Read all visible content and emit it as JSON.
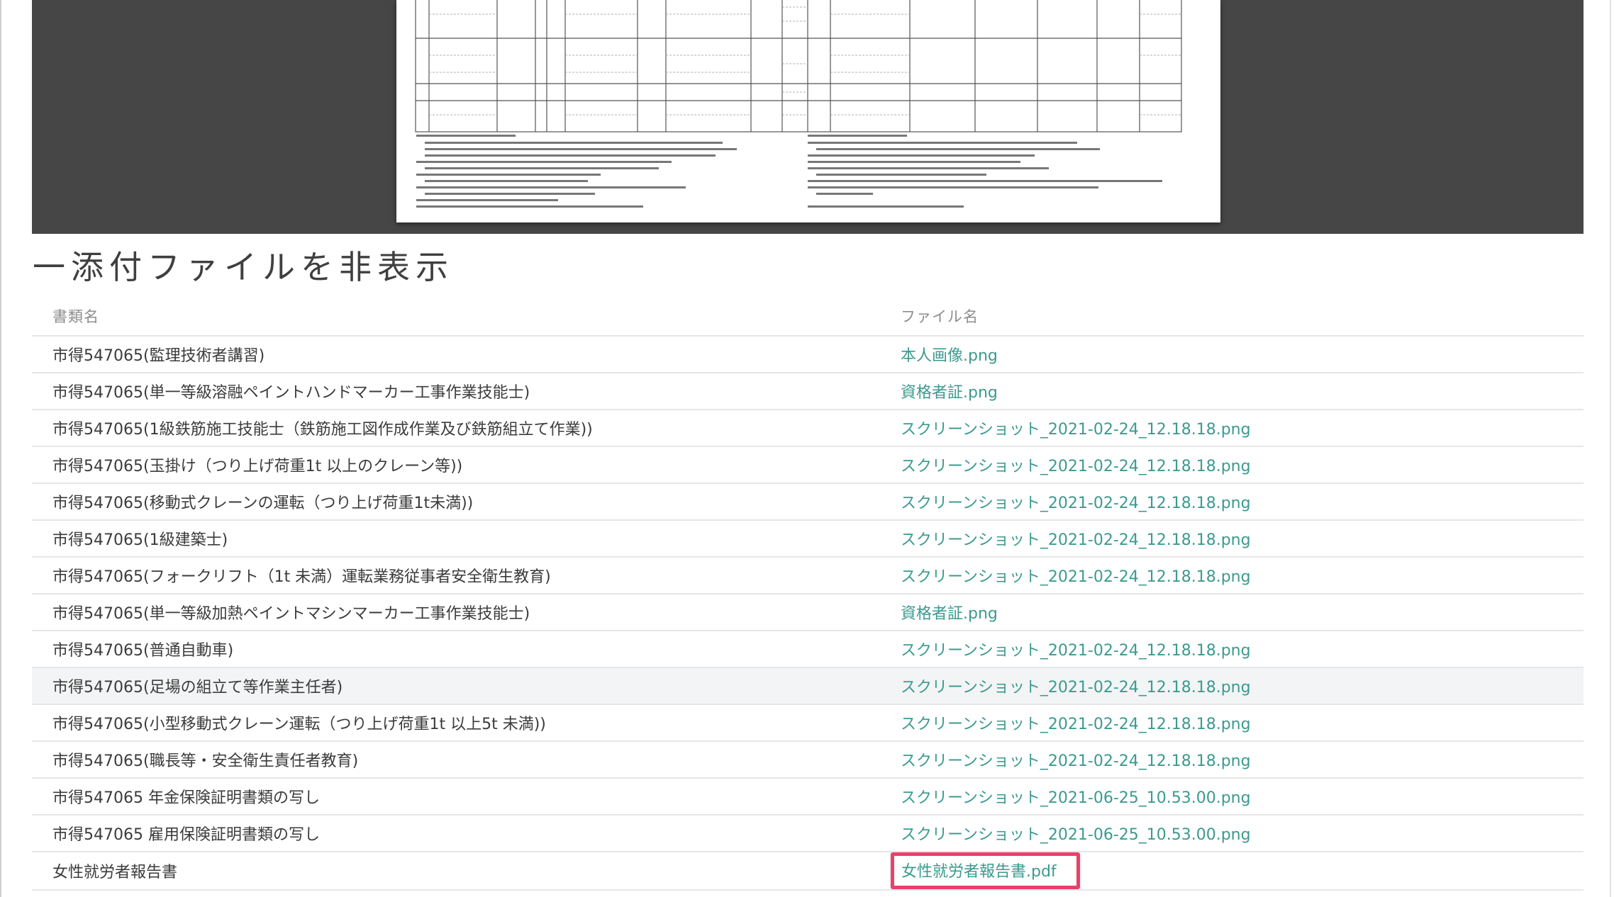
{
  "attachments": {
    "toggle_label": "一添付ファイルを非表示",
    "columns": {
      "document_name": "書類名",
      "file_name": "ファイル名"
    },
    "rows": [
      {
        "document": "市得547065(監理技術者講習)",
        "file": "本人画像.png"
      },
      {
        "document": "市得547065(単一等級溶融ペイントハンドマーカー工事作業技能士)",
        "file": "資格者証.png"
      },
      {
        "document": "市得547065(1級鉄筋施工技能士（鉄筋施工図作成作業及び鉄筋組立て作業))",
        "file": "スクリーンショット_2021-02-24_12.18.18.png"
      },
      {
        "document": "市得547065(玉掛け（つり上げ荷重1t 以上のクレーン等))",
        "file": "スクリーンショット_2021-02-24_12.18.18.png"
      },
      {
        "document": "市得547065(移動式クレーンの運転（つり上げ荷重1t未満))",
        "file": "スクリーンショット_2021-02-24_12.18.18.png"
      },
      {
        "document": "市得547065(1級建築士)",
        "file": "スクリーンショット_2021-02-24_12.18.18.png"
      },
      {
        "document": "市得547065(フォークリフト（1t 未満）運転業務従事者安全衛生教育)",
        "file": "スクリーンショット_2021-02-24_12.18.18.png"
      },
      {
        "document": "市得547065(単一等級加熱ペイントマシンマーカー工事作業技能士)",
        "file": "資格者証.png"
      },
      {
        "document": "市得547065(普通自動車)",
        "file": "スクリーンショット_2021-02-24_12.18.18.png"
      },
      {
        "document": "市得547065(足場の組立て等作業主任者)",
        "file": "スクリーンショット_2021-02-24_12.18.18.png"
      },
      {
        "document": "市得547065(小型移動式クレーン運転（つり上げ荷重1t 以上5t 未満))",
        "file": "スクリーンショット_2021-02-24_12.18.18.png"
      },
      {
        "document": "市得547065(職長等・安全衛生責任者教育)",
        "file": "スクリーンショット_2021-02-24_12.18.18.png"
      },
      {
        "document": "市得547065 年金保険証明書類の写し",
        "file": "スクリーンショット_2021-06-25_10.53.00.png"
      },
      {
        "document": "市得547065 雇用保険証明書類の写し",
        "file": "スクリーンショット_2021-06-25_10.53.00.png"
      },
      {
        "document": "女性就労者報告書",
        "file": "女性就労者報告書.pdf"
      }
    ]
  },
  "colors": {
    "link": "#3c9a8f",
    "highlight": "#e8416c",
    "viewer_bg": "#464646"
  }
}
